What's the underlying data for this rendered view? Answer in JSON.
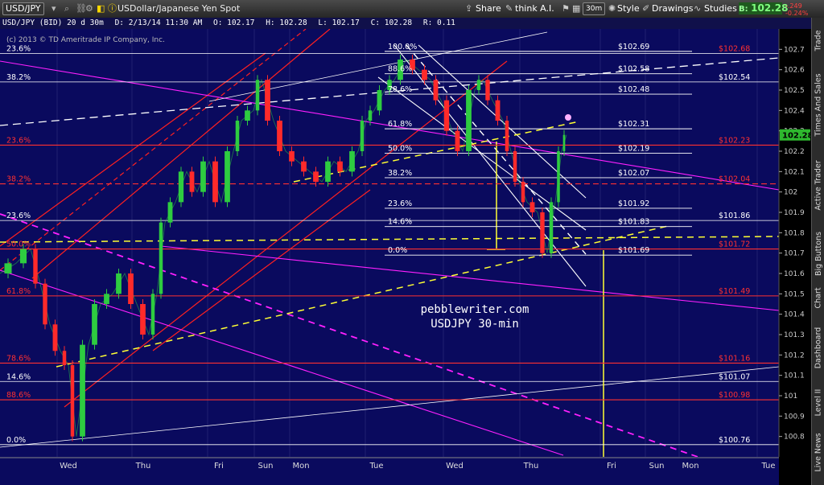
{
  "toolbar": {
    "symbol": "USD/JPY",
    "description": "USDollar/Japanese Yen Spot",
    "share": "Share",
    "think_ai": "think A.I.",
    "interval": "30m",
    "style": "Style",
    "drawings": "Drawings",
    "studies": "Studies",
    "bid_label": "B:",
    "bid_value": "102.28",
    "change_1": "-.249",
    "change_2": "-0.24%"
  },
  "infobar": {
    "symbol": "USD/JPY (BID) 20 d 30m",
    "date": "D: 2/13/14 11:30 AM",
    "open": "O: 102.17",
    "high": "H: 102.28",
    "low": "L: 102.17",
    "close": "C: 102.28",
    "range": "R: 0.11",
    "copyright": "(c) 2013 © TD Ameritrade IP Company, Inc."
  },
  "sidebar": {
    "tabs": [
      "Trade",
      "Times And Sales",
      "Active Trader",
      "Big Buttons",
      "Chart",
      "Dashboard",
      "Level II",
      "Live News"
    ]
  },
  "chart_data": {
    "type": "line",
    "instrument": "USD/JPY",
    "interval": "30m",
    "ylim": [
      100.7,
      102.8
    ],
    "y_ticks": [
      102.7,
      102.6,
      102.5,
      102.4,
      102.3,
      102.2,
      102.1,
      102.0,
      101.9,
      101.8,
      101.7,
      101.6,
      101.5,
      101.4,
      101.3,
      101.2,
      101.1,
      101.0,
      100.9,
      100.8
    ],
    "x_labels": [
      "Wed",
      "Thu",
      "Fri",
      "Sun",
      "Mon",
      "Tue",
      "Wed",
      "Thu",
      "Fri",
      "Sun",
      "Mon",
      "Tue"
    ],
    "last_price": "102.28",
    "watermark": [
      "pebblewriter.com",
      "USDJPY 30-min"
    ],
    "fib_mid": [
      {
        "label": "100.0%",
        "price": 102.69,
        "text": "$102.69"
      },
      {
        "label": "88.6%",
        "price": 102.58,
        "text": "$102.58"
      },
      {
        "label": "78.6%",
        "price": 102.48,
        "text": "$102.48"
      },
      {
        "label": "61.8%",
        "price": 102.31,
        "text": "$102.31"
      },
      {
        "label": "50.0%",
        "price": 102.19,
        "text": "$102.19"
      },
      {
        "label": "38.2%",
        "price": 102.07,
        "text": "$102.07"
      },
      {
        "label": "23.6%",
        "price": 101.92,
        "text": "$101.92"
      },
      {
        "label": "14.6%",
        "price": 101.83,
        "text": "$101.83"
      },
      {
        "label": "0.0%",
        "price": 101.69,
        "text": "$101.69"
      }
    ],
    "fib_left": [
      {
        "label": "23.6%",
        "price": 102.68,
        "color": "#ffffff"
      },
      {
        "label": "38.2%",
        "price": 102.54,
        "color": "#ffffff"
      },
      {
        "label": "23.6%",
        "price": 102.23,
        "color": "#ff3030"
      },
      {
        "label": "38.2%",
        "price": 102.04,
        "color": "#ff3030"
      },
      {
        "label": "23.6%",
        "price": 101.86,
        "color": "#ffffff"
      },
      {
        "label": "50.0%",
        "price": 101.72,
        "color": "#ff3030"
      },
      {
        "label": "61.8%",
        "price": 101.49,
        "color": "#ff3030"
      },
      {
        "label": "78.6%",
        "price": 101.16,
        "color": "#ff3030"
      },
      {
        "label": "14.6%",
        "price": 101.07,
        "color": "#ffffff"
      },
      {
        "label": "88.6%",
        "price": 100.98,
        "color": "#ff3030"
      },
      {
        "label": "0.0%",
        "price": 100.76,
        "color": "#ffffff"
      }
    ],
    "right_levels": [
      {
        "text": "$102.68",
        "price": 102.68,
        "color": "#ff3030"
      },
      {
        "text": "$102.54",
        "price": 102.54,
        "color": "#ffffff"
      },
      {
        "text": "$102.23",
        "price": 102.23,
        "color": "#ff3030"
      },
      {
        "text": "$102.04",
        "price": 102.04,
        "color": "#ff3030"
      },
      {
        "text": "$101.86",
        "price": 101.86,
        "color": "#ffffff"
      },
      {
        "text": "$101.72",
        "price": 101.72,
        "color": "#ff3030"
      },
      {
        "text": "$101.49",
        "price": 101.49,
        "color": "#ff3030"
      },
      {
        "text": "$101.16",
        "price": 101.16,
        "color": "#ff3030"
      },
      {
        "text": "$101.07",
        "price": 101.07,
        "color": "#ffffff"
      },
      {
        "text": "$100.98",
        "price": 100.98,
        "color": "#ff3030"
      },
      {
        "text": "$100.76",
        "price": 100.76,
        "color": "#ffffff"
      }
    ],
    "price_path": [
      [
        0,
        101.6
      ],
      [
        20,
        101.65
      ],
      [
        38,
        101.72
      ],
      [
        50,
        101.55
      ],
      [
        62,
        101.35
      ],
      [
        75,
        101.22
      ],
      [
        85,
        101.15
      ],
      [
        95,
        100.8
      ],
      [
        110,
        101.25
      ],
      [
        125,
        101.45
      ],
      [
        140,
        101.5
      ],
      [
        155,
        101.6
      ],
      [
        170,
        101.45
      ],
      [
        185,
        101.3
      ],
      [
        195,
        101.5
      ],
      [
        205,
        101.85
      ],
      [
        218,
        101.95
      ],
      [
        232,
        102.1
      ],
      [
        245,
        102.0
      ],
      [
        260,
        102.15
      ],
      [
        275,
        101.95
      ],
      [
        290,
        102.2
      ],
      [
        300,
        102.35
      ],
      [
        315,
        102.4
      ],
      [
        325,
        102.55
      ],
      [
        340,
        102.35
      ],
      [
        355,
        102.2
      ],
      [
        370,
        102.15
      ],
      [
        385,
        102.1
      ],
      [
        400,
        102.05
      ],
      [
        415,
        102.15
      ],
      [
        430,
        102.1
      ],
      [
        445,
        102.2
      ],
      [
        455,
        102.35
      ],
      [
        465,
        102.4
      ],
      [
        478,
        102.5
      ],
      [
        490,
        102.55
      ],
      [
        505,
        102.65
      ],
      [
        520,
        102.6
      ],
      [
        535,
        102.55
      ],
      [
        548,
        102.45
      ],
      [
        562,
        102.3
      ],
      [
        575,
        102.2
      ],
      [
        590,
        102.5
      ],
      [
        600,
        102.55
      ],
      [
        612,
        102.45
      ],
      [
        625,
        102.35
      ],
      [
        635,
        102.2
      ],
      [
        645,
        102.05
      ],
      [
        655,
        101.95
      ],
      [
        668,
        101.9
      ],
      [
        680,
        101.7
      ],
      [
        690,
        101.95
      ],
      [
        698,
        102.2
      ],
      [
        704,
        102.28
      ]
    ]
  }
}
